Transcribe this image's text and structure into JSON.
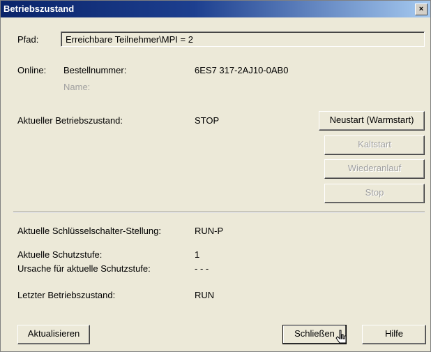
{
  "window": {
    "title": "Betriebszustand",
    "close_label": "×"
  },
  "path": {
    "label": "Pfad:",
    "value": "Erreichbare Teilnehmer\\MPI =  2"
  },
  "online": {
    "label": "Online:",
    "order_label": "Bestellnummer:",
    "order_value": "6ES7 317-2AJ10-0AB0",
    "name_label": "Name:"
  },
  "state": {
    "label": "Aktueller Betriebszustand:",
    "value": "STOP"
  },
  "actions": {
    "restart_warm": "Neustart (Warmstart)",
    "cold_start": "Kaltstart",
    "restart": "Wiederanlauf",
    "stop": "Stop"
  },
  "info": {
    "key_switch_label": "Aktuelle Schlüsselschalter-Stellung:",
    "key_switch_value": "RUN-P",
    "protection_label": "Aktuelle Schutzstufe:",
    "protection_value": "1",
    "cause_label": "Ursache für aktuelle Schutzstufe:",
    "cause_value": "- - -",
    "last_state_label": "Letzter Betriebszustand:",
    "last_state_value": "RUN"
  },
  "footer": {
    "refresh": "Aktualisieren",
    "close": "Schließen",
    "help": "Hilfe"
  }
}
